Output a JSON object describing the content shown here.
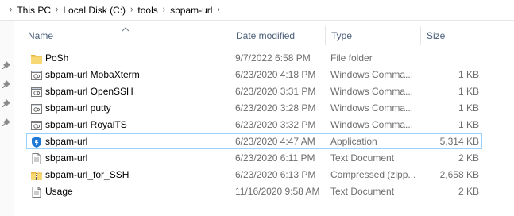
{
  "breadcrumb": [
    "This PC",
    "Local Disk (C:)",
    "tools",
    "sbpam-url"
  ],
  "columns": {
    "name": "Name",
    "date": "Date modified",
    "type": "Type",
    "size": "Size"
  },
  "files": [
    {
      "icon": "folder-icon",
      "name": "PoSh",
      "date": "9/7/2022 6:58 PM",
      "type": "File folder",
      "size": ""
    },
    {
      "icon": "shortcut-file-icon",
      "name": "sbpam-url MobaXterm",
      "date": "6/23/2020 4:18 PM",
      "type": "Windows Comma...",
      "size": "1 KB"
    },
    {
      "icon": "shortcut-file-icon",
      "name": "sbpam-url OpenSSH",
      "date": "6/23/2020 3:31 PM",
      "type": "Windows Comma...",
      "size": "1 KB"
    },
    {
      "icon": "shortcut-file-icon",
      "name": "sbpam-url putty",
      "date": "6/23/2020 3:28 PM",
      "type": "Windows Comma...",
      "size": "1 KB"
    },
    {
      "icon": "shortcut-file-icon",
      "name": "sbpam-url RoyalTS",
      "date": "6/23/2020 3:32 PM",
      "type": "Windows Comma...",
      "size": "1 KB"
    },
    {
      "icon": "application-icon",
      "name": "sbpam-url",
      "date": "6/23/2020 4:47 AM",
      "type": "Application",
      "size": "5,314 KB"
    },
    {
      "icon": "text-document-icon",
      "name": "sbpam-url",
      "date": "6/23/2020 6:11 PM",
      "type": "Text Document",
      "size": "2 KB"
    },
    {
      "icon": "zip-folder-icon",
      "name": "sbpam-url_for_SSH",
      "date": "6/23/2020 6:13 PM",
      "type": "Compressed (zipp...",
      "size": "2,658 KB"
    },
    {
      "icon": "text-document-icon",
      "name": "Usage",
      "date": "11/16/2020 9:58 AM",
      "type": "Text Document",
      "size": "2 KB"
    }
  ],
  "selected_index": 5,
  "colors": {
    "header_text": "#4c607a",
    "selection_border": "#99d1ff",
    "folder": "#f4c75a",
    "app_icon": "#1e78d6"
  }
}
